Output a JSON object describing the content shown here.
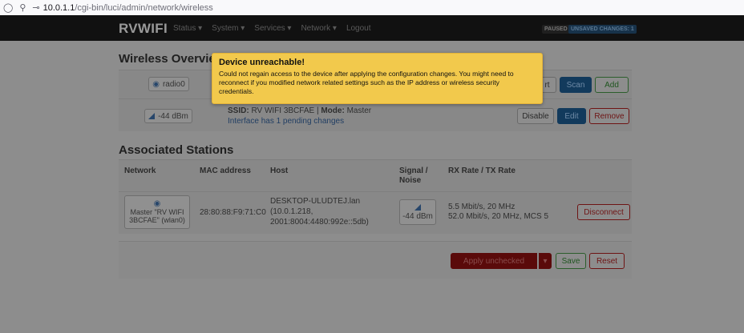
{
  "browser": {
    "url_host": "10.0.1.1",
    "url_path": "/cgi-bin/luci/admin/network/wireless"
  },
  "navbar": {
    "brand": "RVWIFI",
    "menu": [
      "Status ▾",
      "System ▾",
      "Services ▾",
      "Network ▾",
      "Logout"
    ],
    "badge_paused": "PAUSED",
    "badge_unsaved": "UNSAVED CHANGES: 1"
  },
  "wireless": {
    "title": "Wireless Overview",
    "radio": {
      "chip": "radio0",
      "restart_fragment": "rt",
      "scan": "Scan",
      "add": "Add"
    },
    "iface": {
      "signal": "-44 dBm",
      "ssid_label": "SSID:",
      "ssid": "RV WIFI 3BCFAE",
      "mode_label": "Mode:",
      "mode": "Master",
      "pending": "Interface has 1 pending changes",
      "disable": "Disable",
      "edit": "Edit",
      "remove": "Remove"
    }
  },
  "modal": {
    "title": "Device unreachable!",
    "body": "Could not regain access to the device after applying the configuration changes. You might need to reconnect if you modified network related settings such as the IP address or wireless security credentials."
  },
  "stations": {
    "title": "Associated Stations",
    "headers": [
      "Network",
      "MAC address",
      "Host",
      "Signal / Noise",
      "RX Rate / TX Rate"
    ],
    "row": {
      "network": "Master \"RV WIFI 3BCFAE\" (wlan0)",
      "mac": "28:80:88:F9:71:C0",
      "host_l1": "DESKTOP-ULUDTEJ.lan",
      "host_l2": "(10.0.1.218,",
      "host_l3": "2001:8004:4480:992e::5db)",
      "signal": "-44 dBm",
      "rx": "5.5 Mbit/s, 20 MHz",
      "tx": "52.0 Mbit/s, 20 MHz, MCS 5",
      "disconnect": "Disconnect"
    }
  },
  "footer": {
    "apply": "Apply unchecked",
    "apply_caret": "▾",
    "save": "Save",
    "reset": "Reset"
  }
}
